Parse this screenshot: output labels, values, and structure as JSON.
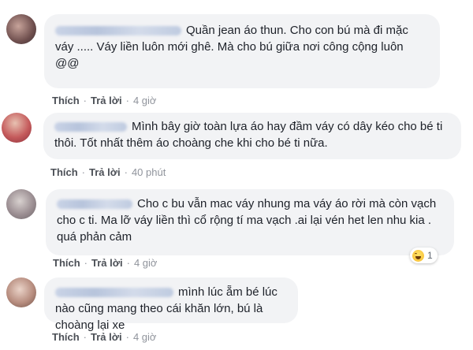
{
  "actions": {
    "like": "Thích",
    "reply": "Trả lời",
    "separator": "·"
  },
  "comments": [
    {
      "text": "Quần jean áo thun. Cho con bú mà đi mặc váy ..... Váy liền luôn mới ghê. Mà cho bú giữa nơi công cộng luôn @@",
      "time": "4 giờ"
    },
    {
      "text": "Mình bây giờ toàn lựa áo hay đầm váy có dây kéo cho bé ti thôi. Tốt nhất thêm áo choàng che khi cho bé ti nữa.",
      "time": "40 phút"
    },
    {
      "text": "Cho c bu vẫn mac váy nhung ma váy áo rời mà còn vạch cho c ti. Ma lỡ váy liền thì cổ rộng tí ma vạch .ai lại vén het len nhu kia . quá phản cảm",
      "time": "4 giờ",
      "reaction": {
        "icon": "haha-reaction-icon",
        "count": "1"
      }
    },
    {
      "text": "mình lúc ẵm bé lúc nào cũng mang theo cái khăn lớn, bú là choàng lại xe",
      "time": "4 giờ"
    }
  ],
  "colors": {
    "bubble": "#f2f3f5",
    "action": "#4b4f56",
    "time": "#90949c"
  }
}
